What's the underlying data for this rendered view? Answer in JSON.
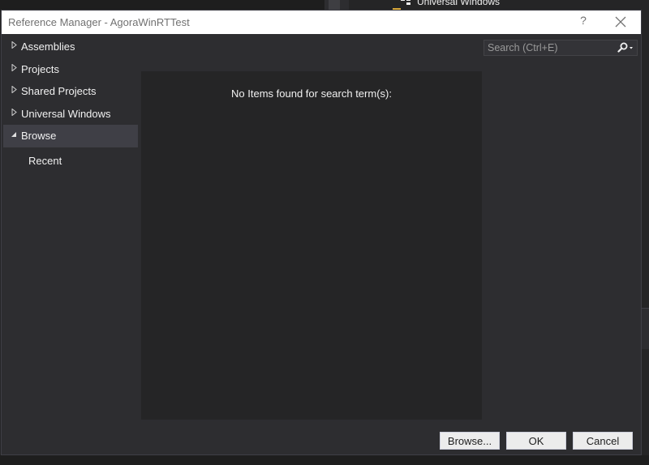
{
  "background": {
    "peek_item_label": "Universal Windows"
  },
  "dialog": {
    "title": "Reference Manager - AgoraWinRTTest",
    "help_label": "?",
    "close_label": "✕"
  },
  "nav": {
    "items": [
      {
        "label": "Assemblies",
        "arrow": "▷",
        "expanded": false,
        "selected": false
      },
      {
        "label": "Projects",
        "arrow": "▷",
        "expanded": false,
        "selected": false
      },
      {
        "label": "Shared Projects",
        "arrow": "▷",
        "expanded": false,
        "selected": false
      },
      {
        "label": "Universal Windows",
        "arrow": "▷",
        "expanded": false,
        "selected": false
      },
      {
        "label": "Browse",
        "arrow": "◢",
        "expanded": true,
        "selected": true
      }
    ],
    "sub_items": [
      {
        "label": "Recent"
      }
    ]
  },
  "search": {
    "placeholder": "Search (Ctrl+E)",
    "value": ""
  },
  "results": {
    "empty_message": "No Items found for search term(s):"
  },
  "footer": {
    "browse_label": "Browse...",
    "ok_label": "OK",
    "cancel_label": "Cancel"
  },
  "colors": {
    "dialog_bg": "#2d2d30",
    "list_bg": "#252526",
    "selected_bg": "#3f3f46",
    "titlebar_bg": "#ffffff",
    "text": "#f1f1f1"
  }
}
